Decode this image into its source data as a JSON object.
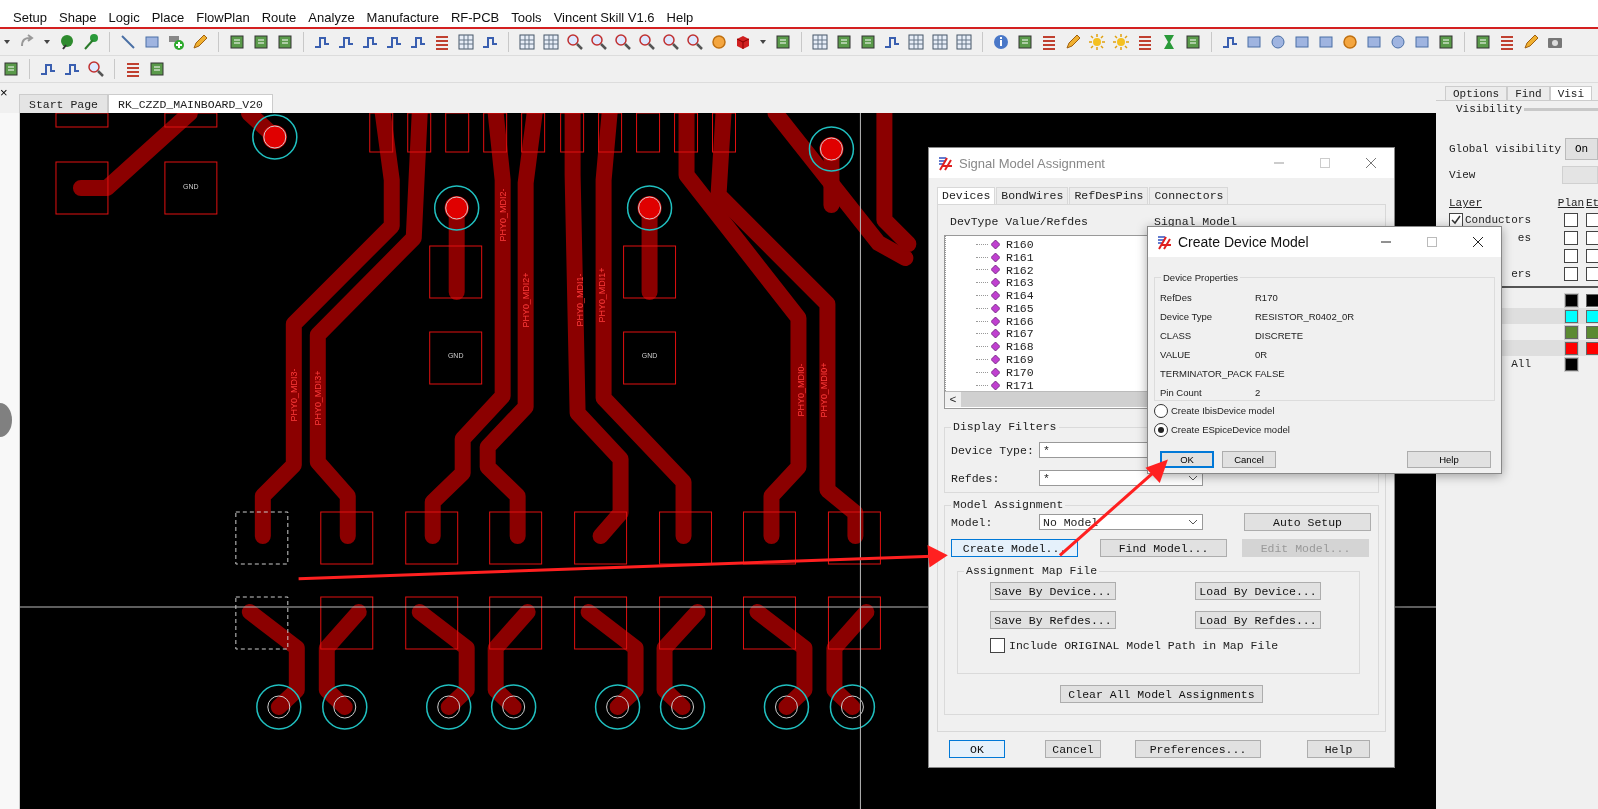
{
  "menu_bar": {
    "items": [
      "Setup",
      "Shape",
      "Logic",
      "Place",
      "FlowPlan",
      "Route",
      "Analyze",
      "Manufacture",
      "RF-PCB",
      "Tools",
      "Vincent Skill V1.6",
      "Help"
    ]
  },
  "document_tabs": {
    "close": "×",
    "tabs": [
      {
        "label": "Start Page",
        "selected": false
      },
      {
        "label": "RK_CZZD_MAINBOARD_V20",
        "selected": true
      }
    ]
  },
  "canvas": {
    "pad_labels": [
      "GND",
      "GND",
      "GND"
    ],
    "trace_labels": [
      "PHY0_MDI3-",
      "PHY0_MDI3+",
      "PHY0_MDI2-",
      "PHY0_MDI2+",
      "PHY0_MDI1-",
      "PHY0_MDI1+",
      "PHY0_MDI0-",
      "PHY0_MDI0+"
    ]
  },
  "side_panel": {
    "tabs": [
      {
        "label": "Options",
        "selected": false
      },
      {
        "label": "Find",
        "selected": false
      },
      {
        "label": "Visi",
        "selected": true
      }
    ],
    "group": "Visibility",
    "global_visibility": {
      "label": "Global visibility",
      "value": "On"
    },
    "view": {
      "label": "View"
    },
    "columns": [
      "Layer",
      "Plan",
      "Et"
    ],
    "layers": [
      {
        "label": "Conductors",
        "checked": true,
        "plan": false,
        "etch": false
      },
      {
        "label": "es",
        "plan": false,
        "etch": false
      },
      {
        "plan": false,
        "etch": false
      },
      {
        "label": "ers",
        "plan": false,
        "etch": false
      }
    ],
    "color_rows": [
      {
        "color": "#000000"
      },
      {
        "color": "#00ffff"
      },
      {
        "color": "#5b8a32"
      },
      {
        "color": "#ff0000"
      },
      {
        "label": "All",
        "color": "#000000"
      }
    ]
  },
  "signal_model_dialog": {
    "title": "Signal Model Assignment",
    "tabs": [
      {
        "label": "Devices",
        "selected": true
      },
      {
        "label": "BondWires",
        "selected": false
      },
      {
        "label": "RefDesPins",
        "selected": false
      },
      {
        "label": "Connectors",
        "selected": false
      }
    ],
    "columns": [
      "DevType Value/Refdes",
      "Signal Model"
    ],
    "tree_items": [
      "R160",
      "R161",
      "R162",
      "R163",
      "R164",
      "R165",
      "R166",
      "R167",
      "R168",
      "R169",
      "R170",
      "R171"
    ],
    "scroll_left": "<",
    "display_filters": {
      "title": "Display Filters",
      "device_type": {
        "label": "Device Type:",
        "value": "*"
      },
      "refdes": {
        "label": "Refdes:",
        "value": "*"
      }
    },
    "model_assignment": {
      "title": "Model Assignment",
      "model": {
        "label": "Model:",
        "value": "No Model"
      },
      "buttons": [
        {
          "label": "Auto Setup",
          "disabled": false,
          "focused": false
        },
        {
          "label": "Create Model...",
          "disabled": false,
          "focused": true
        },
        {
          "label": "Find Model...",
          "disabled": false,
          "focused": false
        },
        {
          "label": "Edit Model...",
          "disabled": true,
          "focused": false
        }
      ],
      "map_file": {
        "title": "Assignment Map File",
        "buttons": [
          "Save By Device...",
          "Load By Device...",
          "Save By Refdes...",
          "Load By Refdes..."
        ],
        "include_original": {
          "label": "Include ORIGINAL Model Path in Map File",
          "checked": false
        }
      },
      "clear_all": "Clear All Model Assignments"
    },
    "footer_buttons": [
      {
        "label": "OK",
        "focused": true
      },
      {
        "label": "Cancel",
        "focused": false
      },
      {
        "label": "Preferences...",
        "focused": false
      },
      {
        "label": "Help",
        "focused": false
      }
    ]
  },
  "create_device_model_dialog": {
    "title": "Create Device Model",
    "group": "Device Properties",
    "properties": [
      {
        "label": "RefDes",
        "value": "R170"
      },
      {
        "label": "Device Type",
        "value": "RESISTOR_R0402_0R"
      },
      {
        "label": "CLASS",
        "value": "DISCRETE"
      },
      {
        "label": "VALUE",
        "value": "0R"
      },
      {
        "label": "TERMINATOR_PACK",
        "value": "FALSE"
      },
      {
        "label": "Pin Count",
        "value": "2"
      }
    ],
    "options": [
      {
        "label": "Create IbisDevice model",
        "selected": false
      },
      {
        "label": "Create ESpiceDevice model",
        "selected": true
      }
    ],
    "buttons": [
      {
        "label": "OK",
        "focused": true
      },
      {
        "label": "Cancel",
        "focused": false
      },
      {
        "label": "Help",
        "focused": false
      }
    ]
  }
}
